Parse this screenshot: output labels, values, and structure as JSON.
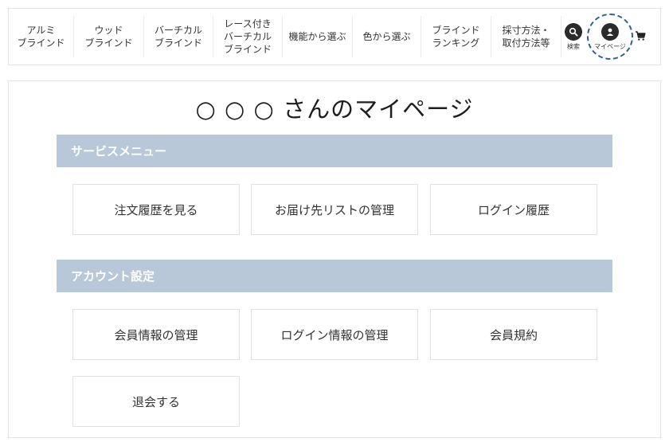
{
  "nav": {
    "items": [
      {
        "lines": [
          "アルミ",
          "ブラインド"
        ]
      },
      {
        "lines": [
          "ウッド",
          "ブラインド"
        ]
      },
      {
        "lines": [
          "バーチカル",
          "ブラインド"
        ]
      },
      {
        "lines": [
          "レース付き",
          "バーチカル",
          "ブラインド"
        ]
      },
      {
        "lines": [
          "機能から選ぶ"
        ]
      },
      {
        "lines": [
          "色から選ぶ"
        ]
      },
      {
        "lines": [
          "ブラインド",
          "ランキング"
        ]
      },
      {
        "lines": [
          "採寸方法・",
          "取付方法等"
        ]
      }
    ],
    "search_label": "検索",
    "mypage_label": "マイページ"
  },
  "page": {
    "title": "○ ○ ○ さんのマイページ"
  },
  "sections": [
    {
      "title": "サービスメニュー",
      "cards": [
        "注文履歴を見る",
        "お届け先リストの管理",
        "ログイン履歴"
      ]
    },
    {
      "title": "アカウント設定",
      "cards": [
        "会員情報の管理",
        "ログイン情報の管理",
        "会員規約",
        "退会する"
      ]
    }
  ],
  "colors": {
    "section_bg": "#b8c8d8",
    "icon_bg": "#2b2b2b",
    "highlight": "#2f5f9c"
  },
  "icons": {
    "search": "search-icon",
    "mypage": "user-icon",
    "cart": "cart-icon"
  }
}
